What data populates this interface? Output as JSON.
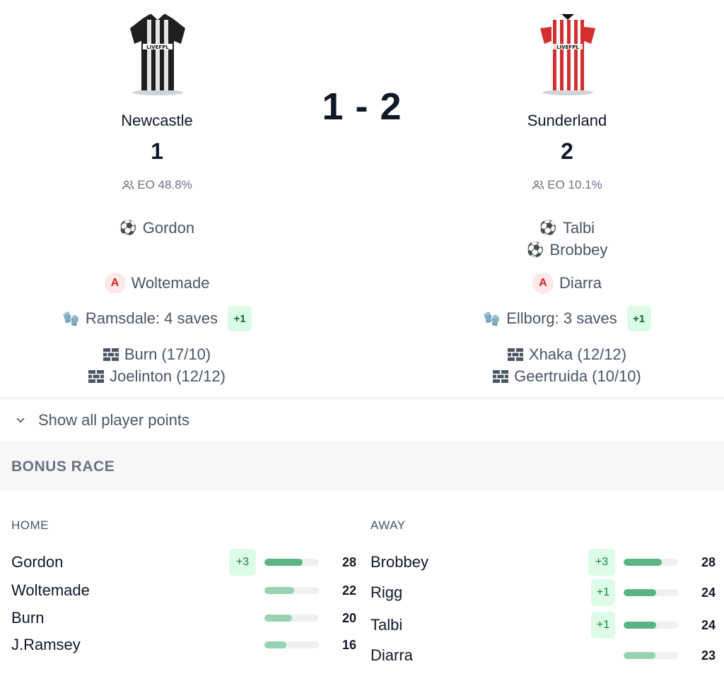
{
  "match": {
    "score_display": "1 - 2",
    "home": {
      "name": "Newcastle",
      "score": "1",
      "eo": "EO 48.8%",
      "jersey_primary": "#1f1f1f",
      "jersey_secondary": "#e5e5e5",
      "goals": [
        "Gordon"
      ],
      "assists": [
        "Woltemade"
      ],
      "saves": {
        "text": "Ramsdale: 4 saves",
        "bonus": "+1"
      },
      "clean_sheets": [
        "Burn (17/10)",
        "Joelinton (12/12)"
      ]
    },
    "away": {
      "name": "Sunderland",
      "score": "2",
      "eo": "EO 10.1%",
      "jersey_primary": "#d32f2f",
      "jersey_secondary": "#ffffff",
      "goals": [
        "Talbi",
        "Brobbey"
      ],
      "assists": [
        "Diarra"
      ],
      "saves": {
        "text": "Ellborg: 3 saves",
        "bonus": "+1"
      },
      "clean_sheets": [
        "Xhaka (12/12)",
        "Geertruida (10/10)"
      ]
    }
  },
  "show_all_label": "Show all player points",
  "bonus_race": {
    "title": "BONUS RACE",
    "home": {
      "label": "HOME",
      "players": [
        {
          "name": "Gordon",
          "bonus": "+3",
          "value": "28",
          "fill": 0.7
        },
        {
          "name": "Woltemade",
          "bonus": "",
          "value": "22",
          "fill": 0.55
        },
        {
          "name": "Burn",
          "bonus": "",
          "value": "20",
          "fill": 0.5
        },
        {
          "name": "J.Ramsey",
          "bonus": "",
          "value": "16",
          "fill": 0.4
        }
      ]
    },
    "away": {
      "label": "AWAY",
      "players": [
        {
          "name": "Brobbey",
          "bonus": "+3",
          "value": "28",
          "fill": 0.7
        },
        {
          "name": "Rigg",
          "bonus": "+1",
          "value": "24",
          "fill": 0.6
        },
        {
          "name": "Talbi",
          "bonus": "+1",
          "value": "24",
          "fill": 0.6
        },
        {
          "name": "Diarra",
          "bonus": "",
          "value": "23",
          "fill": 0.58
        }
      ]
    }
  },
  "colors": {
    "bar_strong": "#5ab584",
    "bar_light": "#96d3b1",
    "badge_bg": "#dcfce7",
    "assist_bg": "#fde8ea",
    "assist_fg": "#dc2626"
  }
}
